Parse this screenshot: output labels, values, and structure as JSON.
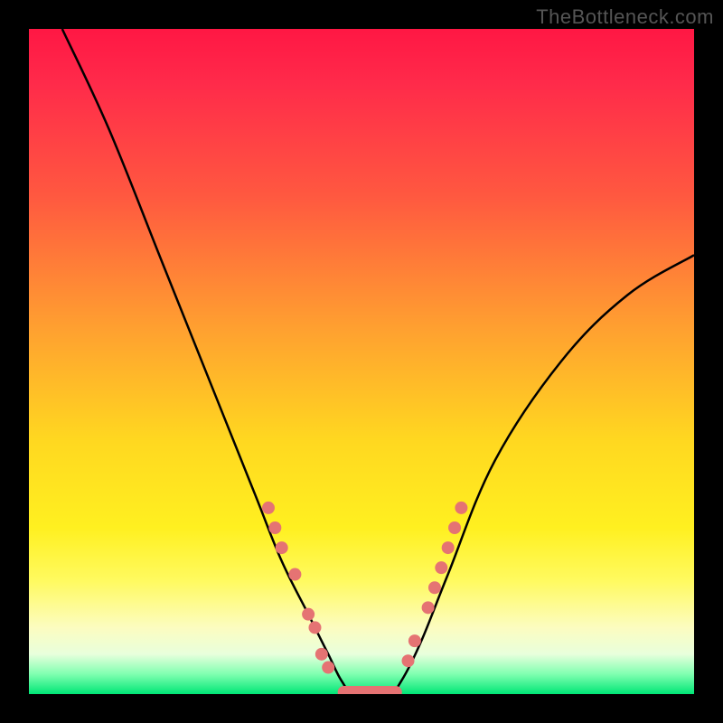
{
  "watermark": "TheBottleneck.com",
  "chart_data": {
    "type": "line",
    "title": "",
    "xlabel": "",
    "ylabel": "",
    "xlim": [
      0,
      100
    ],
    "ylim": [
      0,
      100
    ],
    "background_gradient_stops": [
      {
        "pos": 0.0,
        "color": "#ff1744"
      },
      {
        "pos": 0.08,
        "color": "#ff2a4a"
      },
      {
        "pos": 0.25,
        "color": "#ff5840"
      },
      {
        "pos": 0.45,
        "color": "#ffa030"
      },
      {
        "pos": 0.62,
        "color": "#ffd820"
      },
      {
        "pos": 0.75,
        "color": "#fff020"
      },
      {
        "pos": 0.83,
        "color": "#fffa60"
      },
      {
        "pos": 0.9,
        "color": "#fcfcc0"
      },
      {
        "pos": 0.94,
        "color": "#e8ffdc"
      },
      {
        "pos": 0.97,
        "color": "#80ffb0"
      },
      {
        "pos": 1.0,
        "color": "#00e676"
      }
    ],
    "series": [
      {
        "name": "bottleneck-curve",
        "stroke": "#000000",
        "points": [
          {
            "x": 5,
            "y": 100
          },
          {
            "x": 12,
            "y": 85
          },
          {
            "x": 20,
            "y": 65
          },
          {
            "x": 28,
            "y": 45
          },
          {
            "x": 34,
            "y": 30
          },
          {
            "x": 38,
            "y": 20
          },
          {
            "x": 42,
            "y": 12
          },
          {
            "x": 45,
            "y": 6
          },
          {
            "x": 47,
            "y": 2
          },
          {
            "x": 49,
            "y": 0
          },
          {
            "x": 54,
            "y": 0
          },
          {
            "x": 56,
            "y": 2
          },
          {
            "x": 59,
            "y": 8
          },
          {
            "x": 63,
            "y": 18
          },
          {
            "x": 70,
            "y": 35
          },
          {
            "x": 80,
            "y": 50
          },
          {
            "x": 90,
            "y": 60
          },
          {
            "x": 100,
            "y": 66
          }
        ]
      }
    ],
    "markers": {
      "color": "#e57373",
      "left_cluster": [
        {
          "x": 36,
          "y": 28
        },
        {
          "x": 37,
          "y": 25
        },
        {
          "x": 38,
          "y": 22
        },
        {
          "x": 40,
          "y": 18
        },
        {
          "x": 42,
          "y": 12
        },
        {
          "x": 43,
          "y": 10
        },
        {
          "x": 44,
          "y": 6
        },
        {
          "x": 45,
          "y": 4
        }
      ],
      "bottom_bar": [
        {
          "x": 47.5,
          "y": 0
        },
        {
          "x": 49,
          "y": 0
        },
        {
          "x": 50.5,
          "y": 0
        },
        {
          "x": 52,
          "y": 0
        },
        {
          "x": 53.5,
          "y": 0
        },
        {
          "x": 55,
          "y": 0
        }
      ],
      "right_cluster": [
        {
          "x": 57,
          "y": 5
        },
        {
          "x": 58,
          "y": 8
        },
        {
          "x": 60,
          "y": 13
        },
        {
          "x": 61,
          "y": 16
        },
        {
          "x": 62,
          "y": 19
        },
        {
          "x": 63,
          "y": 22
        },
        {
          "x": 64,
          "y": 25
        },
        {
          "x": 65,
          "y": 28
        }
      ]
    }
  }
}
